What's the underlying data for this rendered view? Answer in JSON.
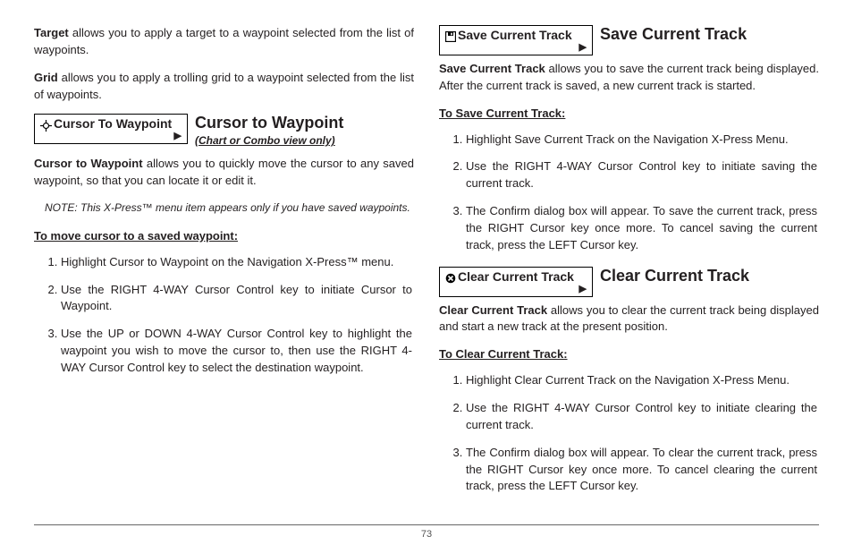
{
  "page_number": "73",
  "left": {
    "target_para_prefix": "Target",
    "target_para_rest": " allows you to apply a target to a waypoint selected from the list of waypoints.",
    "grid_para_prefix": "Grid",
    "grid_para_rest": " allows you to apply a trolling grid to a waypoint selected from the list of waypoints.",
    "cursor": {
      "menu_label": "Cursor To Waypoint",
      "title": "Cursor to Waypoint",
      "subtitle": "(Chart or Combo view only)",
      "desc_prefix": "Cursor to Waypoint",
      "desc_rest": " allows you to quickly move the cursor to any saved waypoint, so that you can locate it or edit it.",
      "note_prefix": "NOTE:",
      "note_rest": " This X-Press™ menu item appears only if you have saved waypoints.",
      "subhead": "To move cursor to a saved waypoint:",
      "steps": [
        "Highlight Cursor to Waypoint on the Navigation X-Press™ menu.",
        "Use the RIGHT 4-WAY Cursor Control key to initiate Cursor to Waypoint.",
        "Use the UP or DOWN 4-WAY Cursor Control key to highlight the waypoint you wish to move the cursor to, then use the RIGHT 4-WAY Cursor Control key to select the destination waypoint."
      ]
    }
  },
  "right": {
    "save": {
      "menu_label": "Save Current Track",
      "title": "Save Current Track",
      "desc_prefix": "Save Current Track",
      "desc_rest": " allows you to save the current track being displayed. After the current track is saved, a new current track is started.",
      "subhead": "To Save Current Track:",
      "steps": [
        "Highlight Save Current Track on the Navigation X-Press Menu.",
        "Use the RIGHT 4-WAY Cursor Control key to initiate saving the current track.",
        "The Confirm dialog box will appear. To save the current track, press the RIGHT Cursor key once more. To cancel saving the current track, press the LEFT Cursor key."
      ]
    },
    "clear": {
      "menu_label": "Clear Current Track",
      "title": "Clear Current Track",
      "desc_prefix": "Clear Current Track",
      "desc_rest": " allows you to clear the current track being displayed and start a new track at the present position.",
      "subhead": "To Clear Current Track:",
      "steps": [
        "Highlight Clear Current Track on the Navigation X-Press Menu.",
        "Use the RIGHT 4-WAY Cursor Control key to initiate clearing the current track.",
        "The Confirm dialog box will appear. To clear the current track, press the RIGHT Cursor key once more. To cancel clearing the current track, press the LEFT Cursor key."
      ]
    }
  }
}
